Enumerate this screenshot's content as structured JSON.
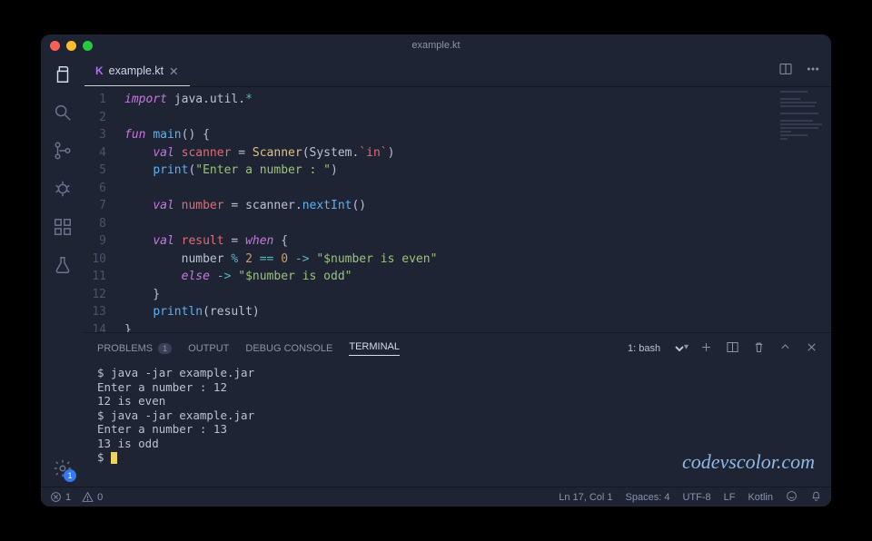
{
  "title": "example.kt",
  "tab": {
    "filename": "example.kt"
  },
  "activity": {
    "settings_badge": "1"
  },
  "code": {
    "lines": [
      {
        "n": 1,
        "html": "<span class='tok-kw'>import</span> <span class='tok-imp'>java.util.</span><span class='tok-op'>*</span>"
      },
      {
        "n": 2,
        "html": ""
      },
      {
        "n": 3,
        "html": "<span class='tok-kw'>fun</span> <span class='tok-fn'>main</span>() {"
      },
      {
        "n": 4,
        "html": "    <span class='tok-kw'>val</span> <span class='tok-var'>scanner</span> = <span class='tok-type'>Scanner</span>(System.<span class='tok-prop'>`in`</span>)"
      },
      {
        "n": 5,
        "html": "    <span class='tok-fn'>print</span>(<span class='tok-str'>\"Enter a number : \"</span>)"
      },
      {
        "n": 6,
        "html": ""
      },
      {
        "n": 7,
        "html": "    <span class='tok-kw'>val</span> <span class='tok-var'>number</span> = scanner.<span class='tok-fn'>nextInt</span>()"
      },
      {
        "n": 8,
        "html": ""
      },
      {
        "n": 9,
        "html": "    <span class='tok-kw'>val</span> <span class='tok-var'>result</span> = <span class='tok-kw'>when</span> {"
      },
      {
        "n": 10,
        "html": "        number <span class='tok-op'>%</span> <span class='tok-num'>2</span> <span class='tok-op'>==</span> <span class='tok-num'>0</span> <span class='tok-op'>-&gt;</span> <span class='tok-str'>\"$number is even\"</span>"
      },
      {
        "n": 11,
        "html": "        <span class='tok-kw'>else</span> <span class='tok-op'>-&gt;</span> <span class='tok-str'>\"$number is odd\"</span>"
      },
      {
        "n": 12,
        "html": "    }"
      },
      {
        "n": 13,
        "html": "    <span class='tok-fn'>println</span>(result)"
      },
      {
        "n": 14,
        "html": "}"
      }
    ]
  },
  "panel": {
    "tabs": {
      "problems": "PROBLEMS",
      "problems_count": "1",
      "output": "OUTPUT",
      "debug": "DEBUG CONSOLE",
      "terminal": "TERMINAL"
    },
    "terminal_select": "1: bash",
    "terminal_lines": [
      "$ java -jar example.jar",
      "Enter a number : 12",
      "12 is even",
      "$ java -jar example.jar",
      "Enter a number : 13",
      "13 is odd",
      "$ "
    ]
  },
  "status": {
    "errors": "1",
    "warnings": "0",
    "lncol": "Ln 17, Col 1",
    "spaces": "Spaces: 4",
    "encoding": "UTF-8",
    "eol": "LF",
    "lang": "Kotlin"
  },
  "watermark": "codevscolor.com"
}
